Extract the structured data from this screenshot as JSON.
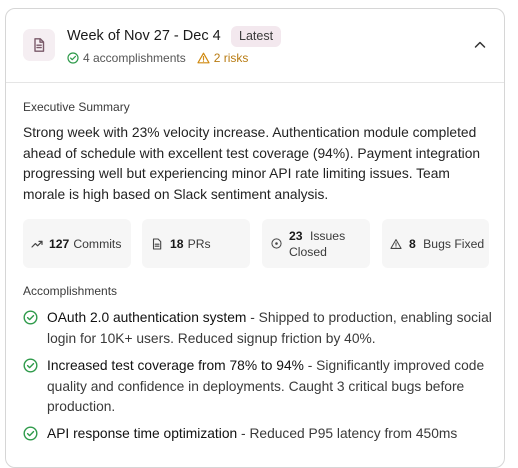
{
  "report": {
    "title": "Week of Nov 27 - Dec 4",
    "badge": "Latest",
    "accomplishments_count": "4 accomplishments",
    "risks_count": "2 risks"
  },
  "summary": {
    "heading": "Executive Summary",
    "text": "Strong week with 23% velocity increase. Authentication module completed ahead of schedule with excellent test coverage (94%). Payment integration progressing well but experiencing minor API rate limiting issues. Team morale is high based on Slack sentiment analysis."
  },
  "stats": [
    {
      "icon": "trend-icon",
      "value": "127",
      "label": "Commits"
    },
    {
      "icon": "file-icon",
      "value": "18",
      "label": "PRs"
    },
    {
      "icon": "circle-check-icon",
      "value": "23",
      "label": "Issues Closed"
    },
    {
      "icon": "bug-icon",
      "value": "8",
      "label": "Bugs Fixed"
    }
  ],
  "accomplishments": {
    "heading": "Accomplishments",
    "items": [
      {
        "title": "OAuth 2.0 authentication system",
        "desc": " - Shipped to production, enabling social login for 10K+ users. Reduced signup friction by 40%."
      },
      {
        "title": "Increased test coverage from 78% to 94%",
        "desc": " - Significantly improved code quality and confidence in deployments. Caught 3 critical bugs before production."
      },
      {
        "title": "API response time optimization",
        "desc": " - Reduced P95 latency from 450ms"
      }
    ]
  },
  "colors": {
    "success": "#2e9a4a",
    "warning": "#d08a12",
    "badge_bg": "#f3e8ee"
  }
}
